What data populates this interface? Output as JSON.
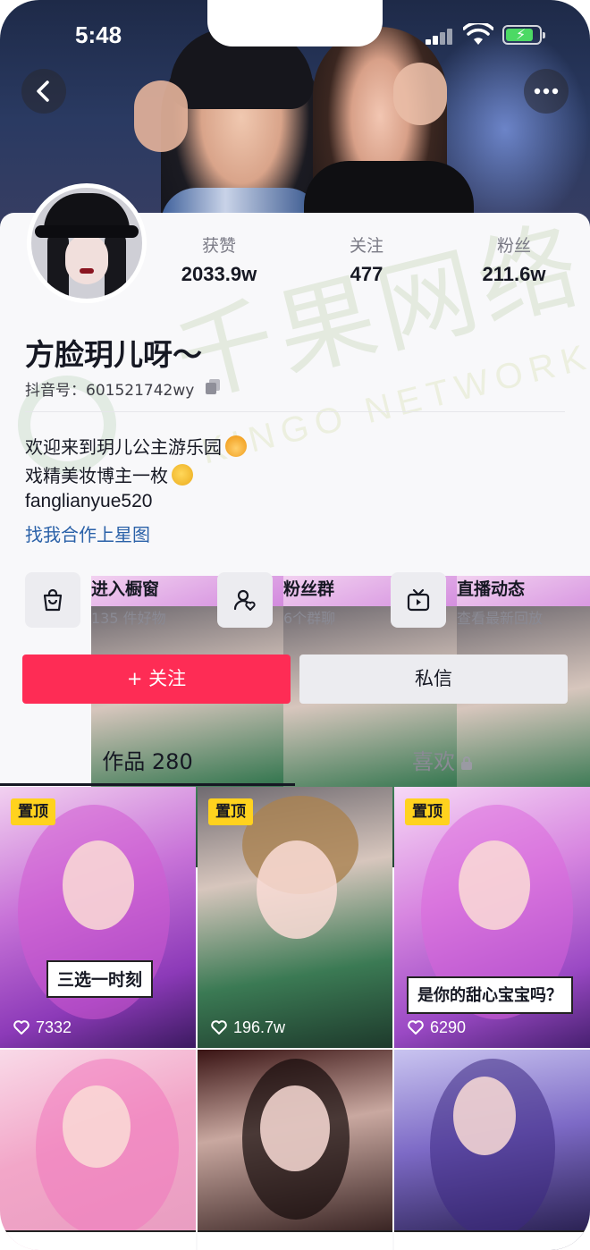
{
  "status_bar": {
    "time": "5:48"
  },
  "profile": {
    "nickname": "方脸玥儿呀～",
    "douyin_id": "抖音号：601521742wy",
    "stats": [
      {
        "label": "获赞",
        "value": "2033.9w"
      },
      {
        "label": "关注",
        "value": "477"
      },
      {
        "label": "粉丝",
        "value": "211.6w"
      }
    ],
    "bio_lines": [
      "欢迎来到玥儿公主游乐园",
      "戏精美妆博主一枚",
      "fanglianyue520"
    ],
    "link_text": "找我合作上星图"
  },
  "shortcuts": [
    {
      "title": "进入橱窗",
      "subtitle": "135 件好物",
      "icon": "shopping-bag-icon"
    },
    {
      "title": "粉丝群",
      "subtitle": "6个群聊",
      "icon": "fan-group-icon"
    },
    {
      "title": "直播动态",
      "subtitle": "查看最新回放",
      "icon": "tv-icon"
    }
  ],
  "actions": {
    "follow": "+ 关注",
    "message": "私信"
  },
  "tabs": {
    "works": "作品 280",
    "likes": "喜欢"
  },
  "watermark": {
    "cn": "千果网络",
    "en": "KINGO NETWORK"
  },
  "videos": [
    {
      "pinned": "置顶",
      "caption": "三选一时刻",
      "likes": "7332"
    },
    {
      "pinned": "置顶",
      "caption": "",
      "likes": "196.7w"
    },
    {
      "pinned": "置顶",
      "caption": "是你的甜心宝宝吗？",
      "likes": "6290"
    },
    {
      "pinned": "",
      "caption": "",
      "likes": ""
    },
    {
      "pinned": "",
      "caption": "",
      "likes": ""
    },
    {
      "pinned": "",
      "caption": "",
      "likes": ""
    }
  ],
  "colors": {
    "accent": "#fe2c55",
    "link": "#2a61a8",
    "pin_badge": "#ffd21e"
  }
}
